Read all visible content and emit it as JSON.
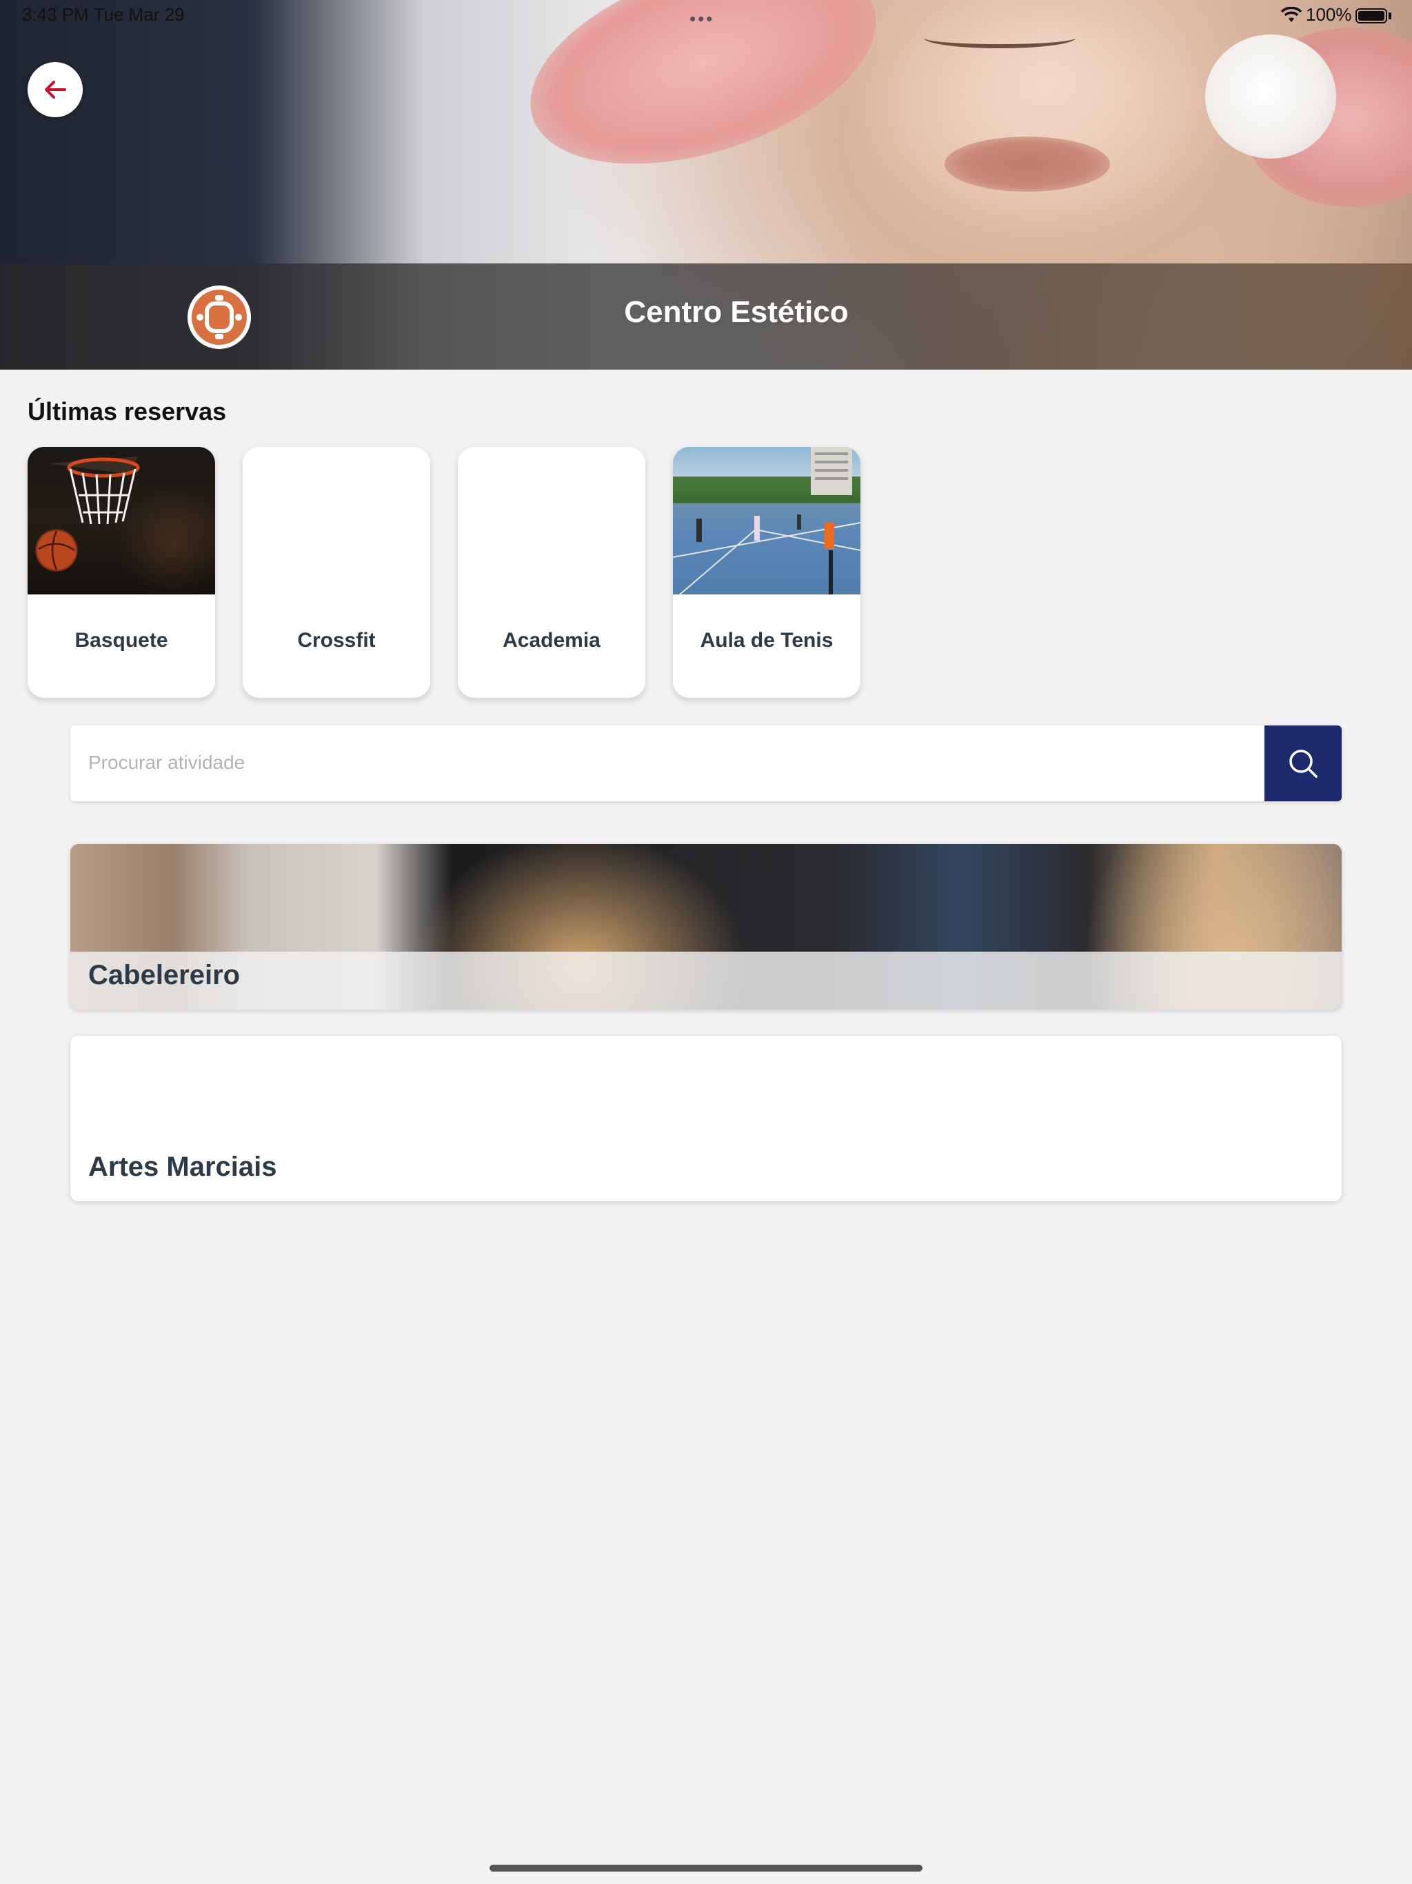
{
  "status_bar": {
    "time": "3:43 PM  Tue Mar 29",
    "dots": "•••",
    "battery": "100%"
  },
  "header": {
    "title": "Centro Estético"
  },
  "recent": {
    "title": "Últimas reservas",
    "items": [
      {
        "label": "Basquete"
      },
      {
        "label": "Crossfit"
      },
      {
        "label": "Academia"
      },
      {
        "label": "Aula de Tenis"
      }
    ]
  },
  "search": {
    "placeholder": "Procurar atividade"
  },
  "categories": [
    {
      "name": "Cabelereiro"
    },
    {
      "name": "Artes Marciais"
    }
  ],
  "colors": {
    "accent": "#1d2a6b",
    "back_arrow": "#c8102e",
    "logo": "#d9703f"
  }
}
